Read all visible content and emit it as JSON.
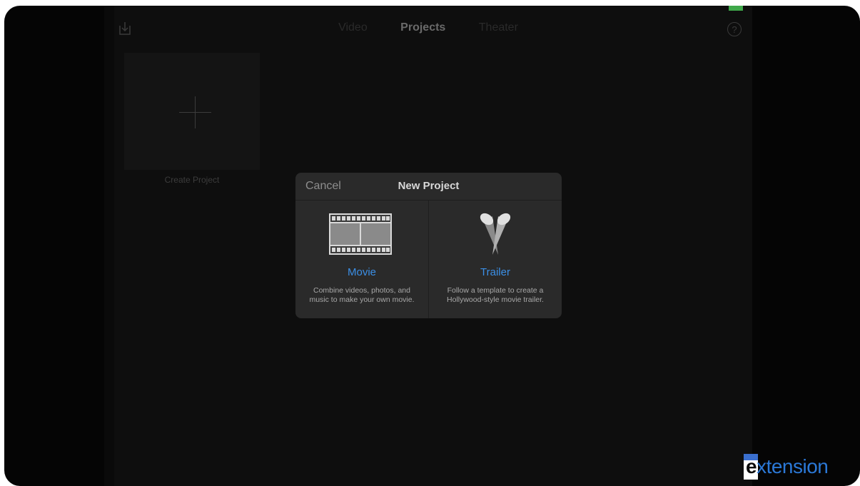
{
  "nav": {
    "tabs": [
      {
        "label": "Video",
        "active": false
      },
      {
        "label": "Projects",
        "active": true
      },
      {
        "label": "Theater",
        "active": false
      }
    ],
    "help_icon": "question-circle-icon",
    "import_icon": "import-icon"
  },
  "projects": {
    "create_label": "Create Project"
  },
  "dialog": {
    "cancel_label": "Cancel",
    "title": "New Project",
    "options": [
      {
        "title": "Movie",
        "description_line1": "Combine videos, photos, and",
        "description_line2": "music to make your own movie.",
        "icon": "film-strip-icon"
      },
      {
        "title": "Trailer",
        "description_line1": "Follow a template to create a",
        "description_line2": "Hollywood-style movie trailer.",
        "icon": "spotlights-icon"
      }
    ]
  },
  "watermark": {
    "first_letter": "e",
    "rest": "xtension"
  },
  "colors": {
    "accent": "#3b8fe6",
    "background": "#0e0e0e",
    "dialog": "#2a2a2a",
    "status_green": "#3fa84a"
  }
}
